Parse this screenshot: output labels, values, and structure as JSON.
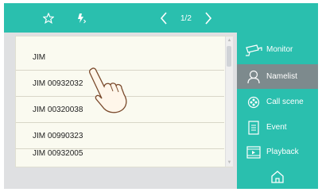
{
  "topbar": {
    "favorite_icon": "star-icon",
    "flash_icon": "flash-icon",
    "page_indicator": "1/2"
  },
  "namelist": {
    "rows": [
      "JIM",
      "JIM 00932032",
      "JIM 00320038",
      "JIM 00990323",
      "JIM 00932005"
    ]
  },
  "sidebar": {
    "items": [
      {
        "label": "Monitor",
        "icon": "camera-icon"
      },
      {
        "label": "Namelist",
        "icon": "person-icon"
      },
      {
        "label": "Call scene",
        "icon": "call-scene-icon"
      },
      {
        "label": "Event",
        "icon": "event-icon"
      },
      {
        "label": "Playback",
        "icon": "playback-icon"
      }
    ],
    "home_icon": "home-icon",
    "accent_color": "#2abfae",
    "active_color": "#7d8a8d"
  }
}
